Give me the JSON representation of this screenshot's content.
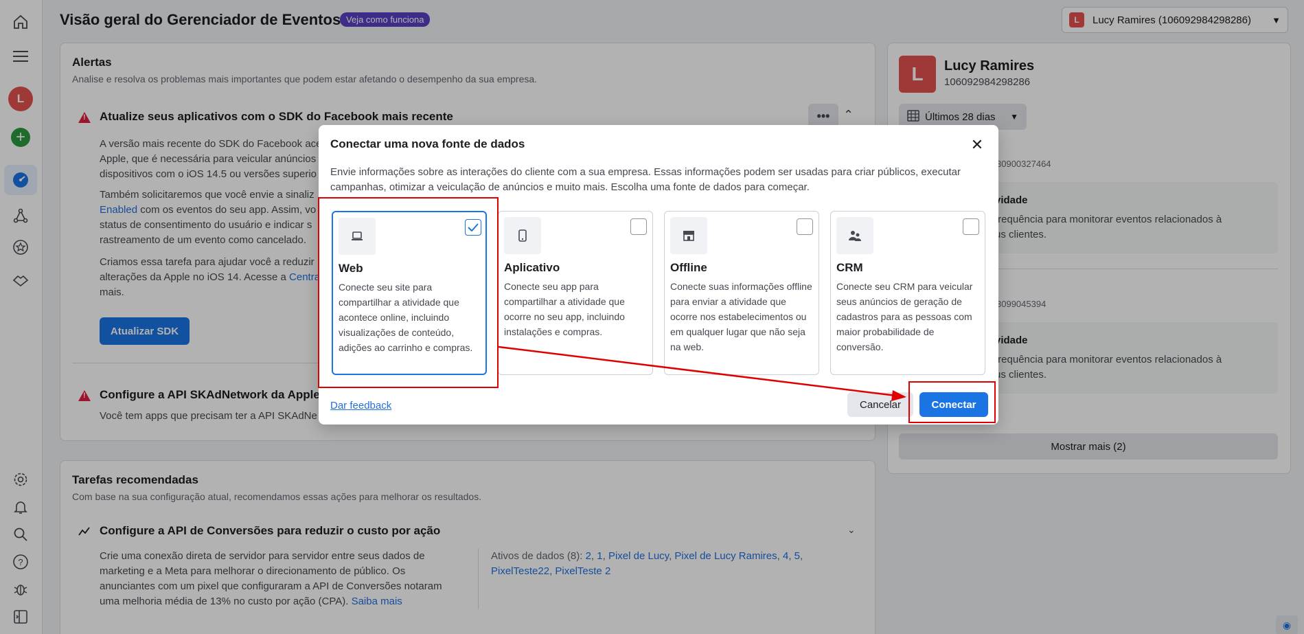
{
  "header": {
    "title": "Visão geral do Gerenciador de Eventos",
    "how_badge": "Veja como funciona",
    "account_avatar": "L",
    "account_label": "Lucy Ramires (106092984298286)"
  },
  "rail": {
    "avatar_letter": "L",
    "icons": [
      "home-icon",
      "menu-icon",
      "avatar",
      "add-icon",
      "dashboard-icon",
      "connections-icon",
      "star-icon",
      "handshake-icon",
      "gear-icon",
      "bell-icon",
      "search-icon",
      "help-icon",
      "bug-icon",
      "panel-icon"
    ]
  },
  "alerts": {
    "title": "Alertas",
    "subtitle": "Analise e resolva os problemas mais importantes que podem estar afetando o desempenho da sua empresa.",
    "alert1": {
      "title": "Atualize seus aplicativos com o SDK do Facebook mais recente",
      "p1_line1": "A versão mais recente do SDK do Facebook ace",
      "p1_line2": "Apple, que é necessária para veicular anúncios",
      "p1_line3": "dispositivos com o iOS 14.5 ou versões superio",
      "p2_line1": "Também solicitaremos que você envie a sinaliz",
      "p2_link": "Enabled",
      "p2_line2_rest": " com os eventos do seu app. Assim, vo",
      "p2_line3": "status de consentimento do usuário e indicar s",
      "p2_line4": "rastreamento de um evento como cancelado.",
      "p3_line1": "Criamos essa tarefa para ajudar você a reduzir",
      "p3_line2_pre": "alterações da Apple no iOS 14. Acesse a ",
      "p3_link": "Centra",
      "p3_line3": "mais.",
      "button": "Atualizar SDK",
      "more_label": "•••",
      "collapse_label": "⌃"
    },
    "alert2": {
      "title": "Configure a API SKAdNetwork da Apple p",
      "text": "Você tem apps que precisam ter a API SKAdNe"
    }
  },
  "tasks": {
    "title": "Tarefas recomendadas",
    "subtitle": "Com base na sua configuração atual, recomendamos essas ações para melhorar os resultados.",
    "item_title": "Configure a API de Conversões para reduzir o custo por ação",
    "item_text_l1": "Crie uma conexão direta de servidor para servidor entre seus dados de",
    "item_text_l2": "marketing e a Meta para melhorar o direcionamento de público. Os",
    "item_text_l3": "anunciantes com um pixel que configuraram a API de Conversões notaram",
    "item_text_l4": "uma melhoria média de 13% no custo por ação (CPA). ",
    "item_link": "Saiba mais",
    "assets_label": "Ativos de dados (8): ",
    "assets": [
      "2",
      "1",
      "Pixel de Lucy",
      "Pixel de Lucy Ramires",
      "4",
      "5",
      "PixelTeste22",
      "PixelTeste 2"
    ]
  },
  "right": {
    "avatar": "L",
    "name": "Lucy Ramires",
    "id": "106092984298286",
    "date_range": "Últimos 28 dias",
    "item1_id": "30900327464",
    "item1_title": "vidade",
    "item1_l1": "frequência para monitorar eventos relacionados à",
    "item1_l2": "us clientes.",
    "item2_id": "3099045394",
    "item2_title": "vidade",
    "item2_l1": "frequência para monitorar eventos relacionados à",
    "item2_l2": "us clientes.",
    "show_more": "Mostrar mais (2)"
  },
  "modal": {
    "title": "Conectar uma nova fonte de dados",
    "description": "Envie informações sobre as interações do cliente com a sua empresa. Essas informações podem ser usadas para criar públicos, executar campanhas, otimizar a veiculação de anúncios e muito mais. Escolha uma fonte de dados para começar.",
    "sources": [
      {
        "name": "Web",
        "icon": "laptop-icon",
        "selected": true,
        "description": "Conecte seu site para compartilhar a atividade que acontece online, incluindo visualizações de conteúdo, adições ao carrinho e compras."
      },
      {
        "name": "Aplicativo",
        "icon": "phone-icon",
        "selected": false,
        "description": "Conecte seu app para compartilhar a atividade que ocorre no seu app, incluindo instalações e compras."
      },
      {
        "name": "Offline",
        "icon": "store-icon",
        "selected": false,
        "description": "Conecte suas informações offline para enviar a atividade que ocorre nos estabelecimentos ou em qualquer lugar que não seja na web."
      },
      {
        "name": "CRM",
        "icon": "people-icon",
        "selected": false,
        "description": "Conecte seu CRM para veicular seus anúncios de geração de cadastros para as pessoas com maior probabilidade de conversão."
      }
    ],
    "feedback": "Dar feedback",
    "cancel": "Cancelar",
    "connect": "Conectar"
  },
  "colors": {
    "accent": "#1b74e4",
    "annotation": "#e00000",
    "warning": "#e41e3f",
    "badge": "#5b3fc4"
  }
}
